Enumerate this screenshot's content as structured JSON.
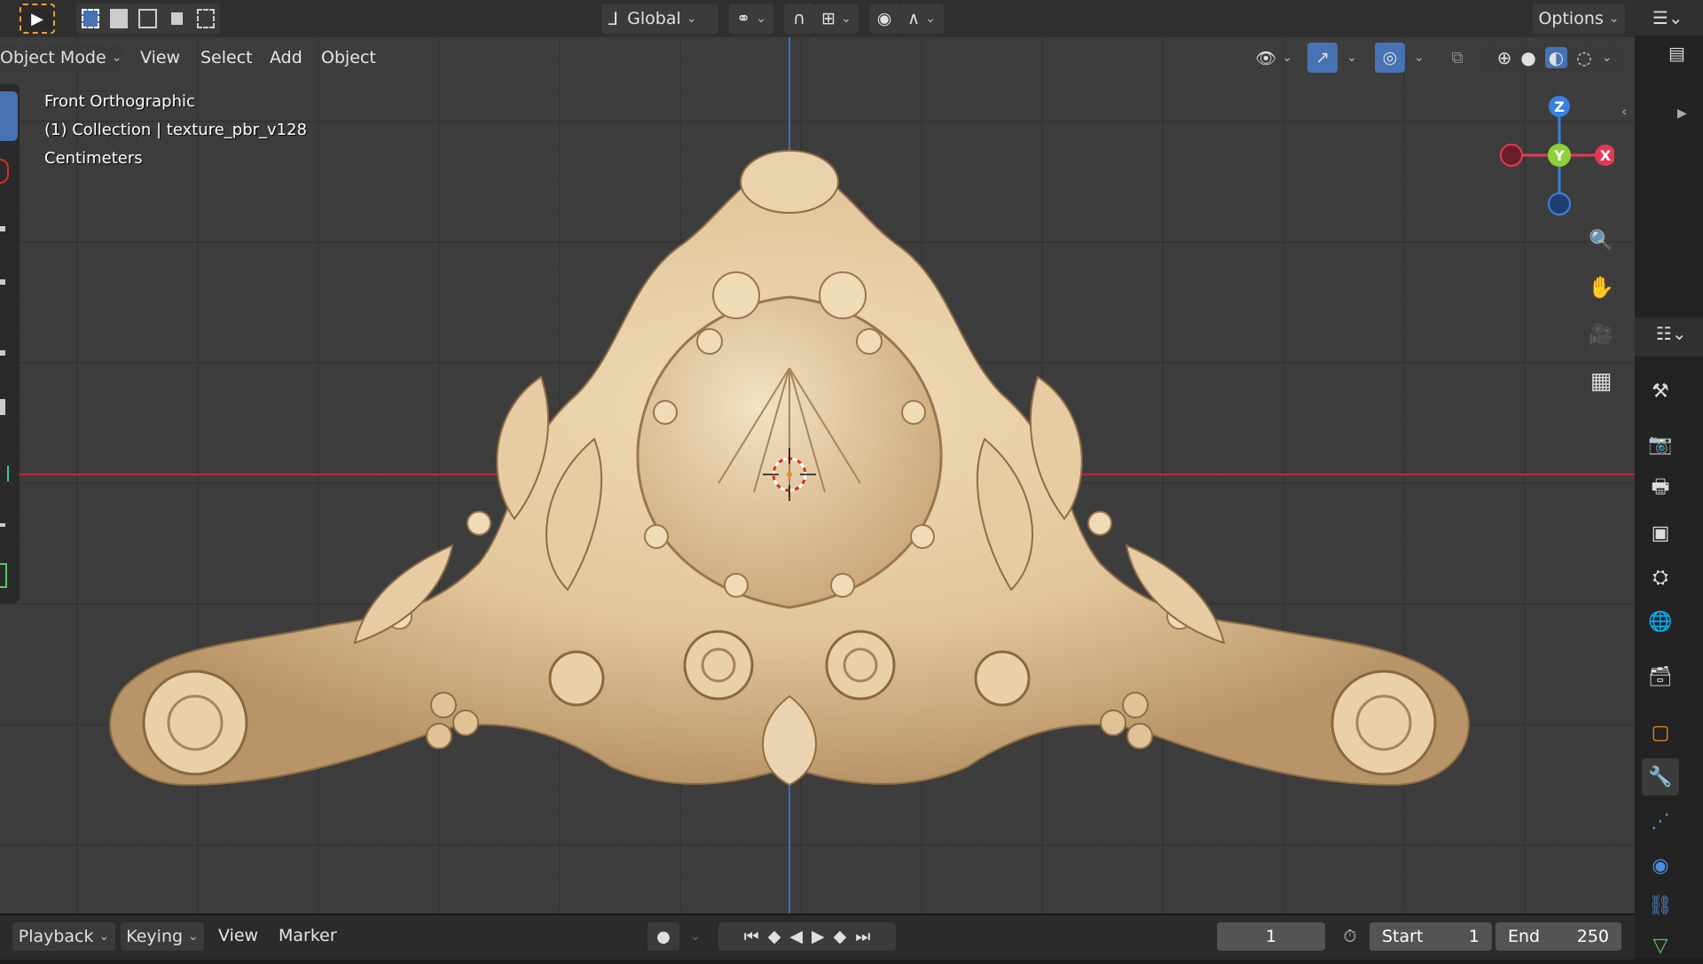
{
  "toolbar": {
    "transform_orientation": "Global",
    "options_label": "Options"
  },
  "header": {
    "mode": "Object Mode",
    "menus": [
      "View",
      "Select",
      "Add",
      "Object"
    ]
  },
  "overlay": {
    "view_name": "Front Orthographic",
    "collection": "(1) Collection | texture_pbr_v128",
    "units": "Centimeters"
  },
  "gizmo": {
    "z": "Z",
    "y": "Y",
    "x": "X",
    "colors": {
      "x": "#e53950",
      "y": "#8bd13a",
      "z": "#3b7fe0"
    }
  },
  "timeline": {
    "playback": "Playback",
    "keying": "Keying",
    "view": "View",
    "marker": "Marker",
    "current_frame": "1",
    "start_label": "Start",
    "start_value": "1",
    "end_label": "End",
    "end_value": "250"
  },
  "colors": {
    "x_axis": "#c2283a",
    "z_axis": "#3570c4",
    "model": "#e4c9a1",
    "active_blue": "#4772b3"
  }
}
